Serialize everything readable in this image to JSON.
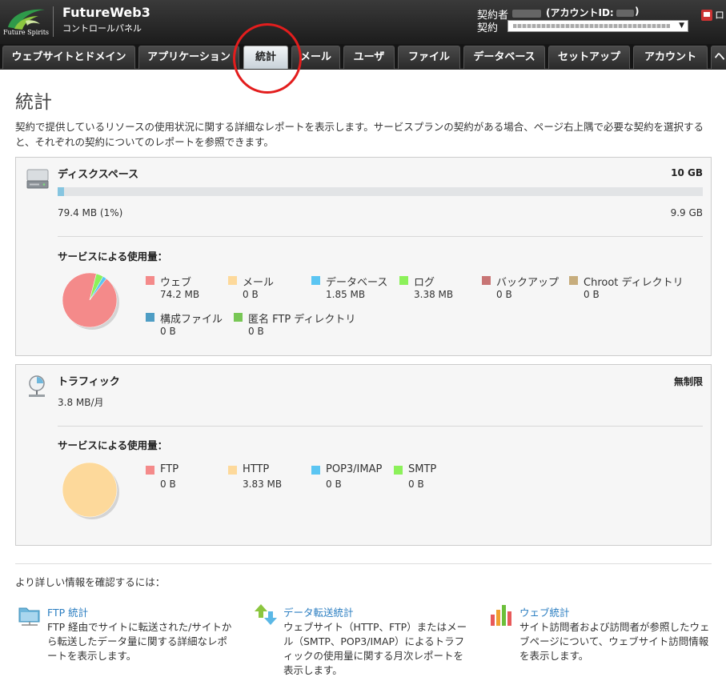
{
  "header": {
    "brand": "Future Spirits",
    "app_title": "FutureWeb3",
    "app_subtitle": "コントロールパネル",
    "account_holder_label": "契約者",
    "account_id_label": "(アカウントID:",
    "account_id_close": ")",
    "contract_label": "契約",
    "logout_label": "ロ"
  },
  "tabs": [
    {
      "label": "ウェブサイトとドメイン"
    },
    {
      "label": "アプリケーション"
    },
    {
      "label": "統計",
      "active": true
    },
    {
      "label": "メール"
    },
    {
      "label": "ユーザ"
    },
    {
      "label": "ファイル"
    },
    {
      "label": "データベース"
    },
    {
      "label": "セットアップ"
    },
    {
      "label": "アカウント"
    },
    {
      "label": "ヘ"
    }
  ],
  "page": {
    "title": "統計",
    "description": "契約で提供しているリソースの使用状況に関する詳細なレポートを表示します。サービスプランの契約がある場合、ページ右上隅で必要な契約を選択すると、それぞれの契約についてのレポートを参照できます。"
  },
  "disk": {
    "title": "ディスクスペース",
    "total": "10 GB",
    "used": "79.4 MB (1%)",
    "used_fraction": 0.01,
    "free": "9.9 GB",
    "usage_title": "サービスによる使用量：",
    "legend": [
      {
        "label": "ウェブ",
        "value": "74.2 MB",
        "color": "#f48a8a",
        "mb": 74.2
      },
      {
        "label": "メール",
        "value": "0 B",
        "color": "#fdd99b",
        "mb": 0
      },
      {
        "label": "データベース",
        "value": "1.85 MB",
        "color": "#5bc5f2",
        "mb": 1.85
      },
      {
        "label": "ログ",
        "value": "3.38 MB",
        "color": "#8cf15a",
        "mb": 3.38
      },
      {
        "label": "バックアップ",
        "value": "0 B",
        "color": "#c87575",
        "mb": 0
      },
      {
        "label": "Chroot ディレクトリ",
        "value": "0 B",
        "color": "#c7ad7d",
        "mb": 0
      },
      {
        "label": "構成ファイル",
        "value": "0 B",
        "color": "#4e9dc4",
        "mb": 0
      },
      {
        "label": "匿名 FTP ディレクトリ",
        "value": "0 B",
        "color": "#78c755",
        "mb": 0
      }
    ]
  },
  "traffic": {
    "title": "トラフィック",
    "limit": "無制限",
    "value": "3.8 MB/月",
    "usage_title": "サービスによる使用量：",
    "legend": [
      {
        "label": "FTP",
        "value": "0 B",
        "color": "#f48a8a",
        "mb": 0
      },
      {
        "label": "HTTP",
        "value": "3.83 MB",
        "color": "#fdd99b",
        "mb": 3.83
      },
      {
        "label": "POP3/IMAP",
        "value": "0 B",
        "color": "#5bc5f2",
        "mb": 0
      },
      {
        "label": "SMTP",
        "value": "0 B",
        "color": "#8cf15a",
        "mb": 0
      }
    ]
  },
  "more_info": {
    "heading": "より詳しい情報を確認するには：",
    "links": [
      {
        "title": "FTP 統計",
        "description": "FTP 経由でサイトに転送された/サイトから転送したデータ量に関する詳細なレポートを表示します。"
      },
      {
        "title": "データ転送統計",
        "description": "ウェブサイト（HTTP、FTP）またはメール（SMTP、POP3/IMAP）によるトラフィックの使用量に関する月次レポートを表示します。"
      },
      {
        "title": "ウェブ統計",
        "description": "サイト訪問者および訪問者が参照したウェブページについて、ウェブサイト訪問情報を表示します。"
      }
    ]
  }
}
